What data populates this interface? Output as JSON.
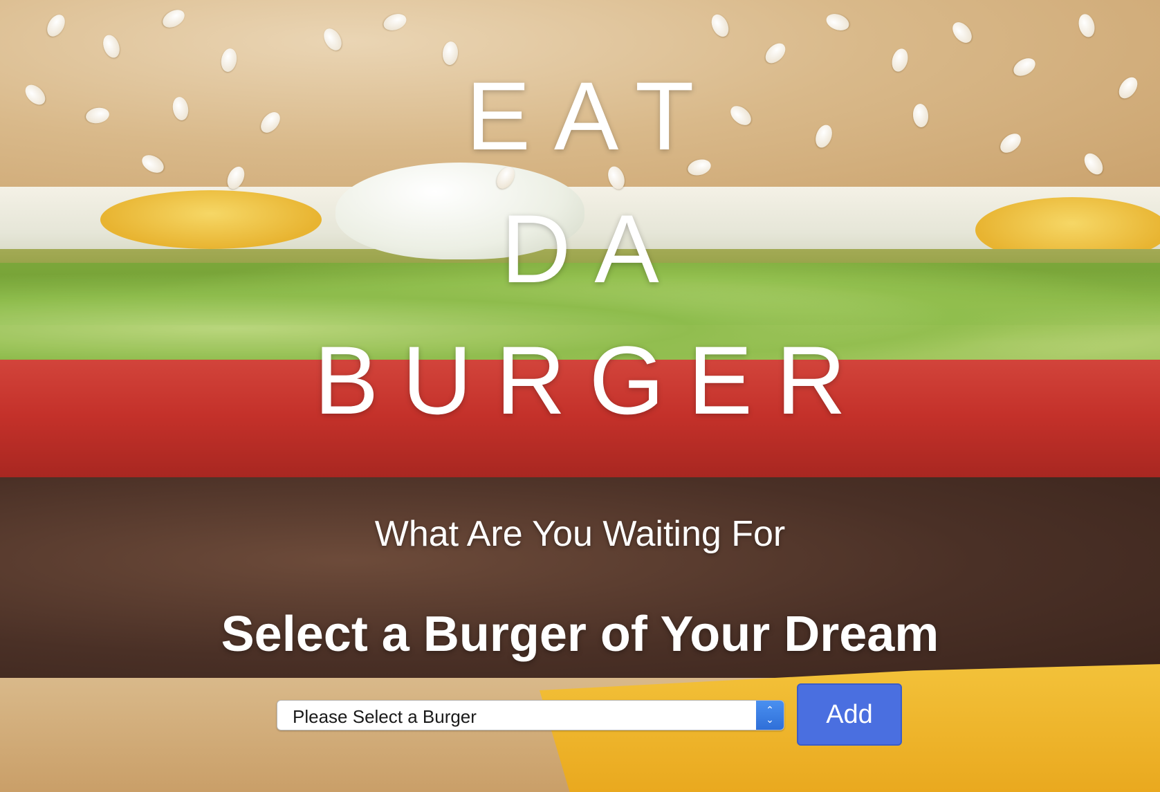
{
  "hero": {
    "headline_line1": "EAT",
    "headline_line2": "DA",
    "headline_line3": "BURGER",
    "tagline": "What Are You Waiting For",
    "prompt": "Select a Burger of Your Dream"
  },
  "order_form": {
    "select_value": "Please Select a Burger",
    "add_label": "Add"
  },
  "colors": {
    "headline_text": "#ffffff",
    "add_button": "#4a6fe0",
    "select_arrow": "#2f6fd8"
  },
  "icons": {
    "select_arrows": "chevron-up-down-icon"
  }
}
